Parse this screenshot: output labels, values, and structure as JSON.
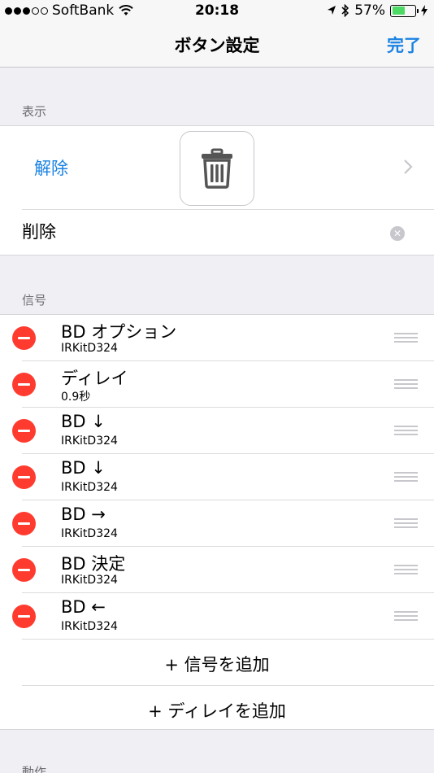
{
  "status_bar": {
    "carrier": "SoftBank",
    "time": "20:18",
    "battery_percent": "57%",
    "battery_level": 0.57
  },
  "nav": {
    "title": "ボタン設定",
    "done_label": "完了"
  },
  "display_section": {
    "header": "表示",
    "unlock_label": "解除",
    "name_value": "削除"
  },
  "signal_section": {
    "header": "信号",
    "items": [
      {
        "title": "BD オプション",
        "subtitle": "IRKitD324"
      },
      {
        "title": "ディレイ",
        "subtitle": "0.9秒"
      },
      {
        "title": "BD ↓",
        "subtitle": "IRKitD324"
      },
      {
        "title": "BD ↓",
        "subtitle": "IRKitD324"
      },
      {
        "title": "BD →",
        "subtitle": "IRKitD324"
      },
      {
        "title": "BD 決定",
        "subtitle": "IRKitD324"
      },
      {
        "title": "BD ←",
        "subtitle": "IRKitD324"
      }
    ],
    "add_signal_label": "+ 信号を追加",
    "add_delay_label": "+ ディレイを追加"
  },
  "action_section": {
    "header": "動作"
  },
  "colors": {
    "accent": "#1a82e2",
    "delete": "#ff3b30",
    "battery": "#4cd964"
  }
}
